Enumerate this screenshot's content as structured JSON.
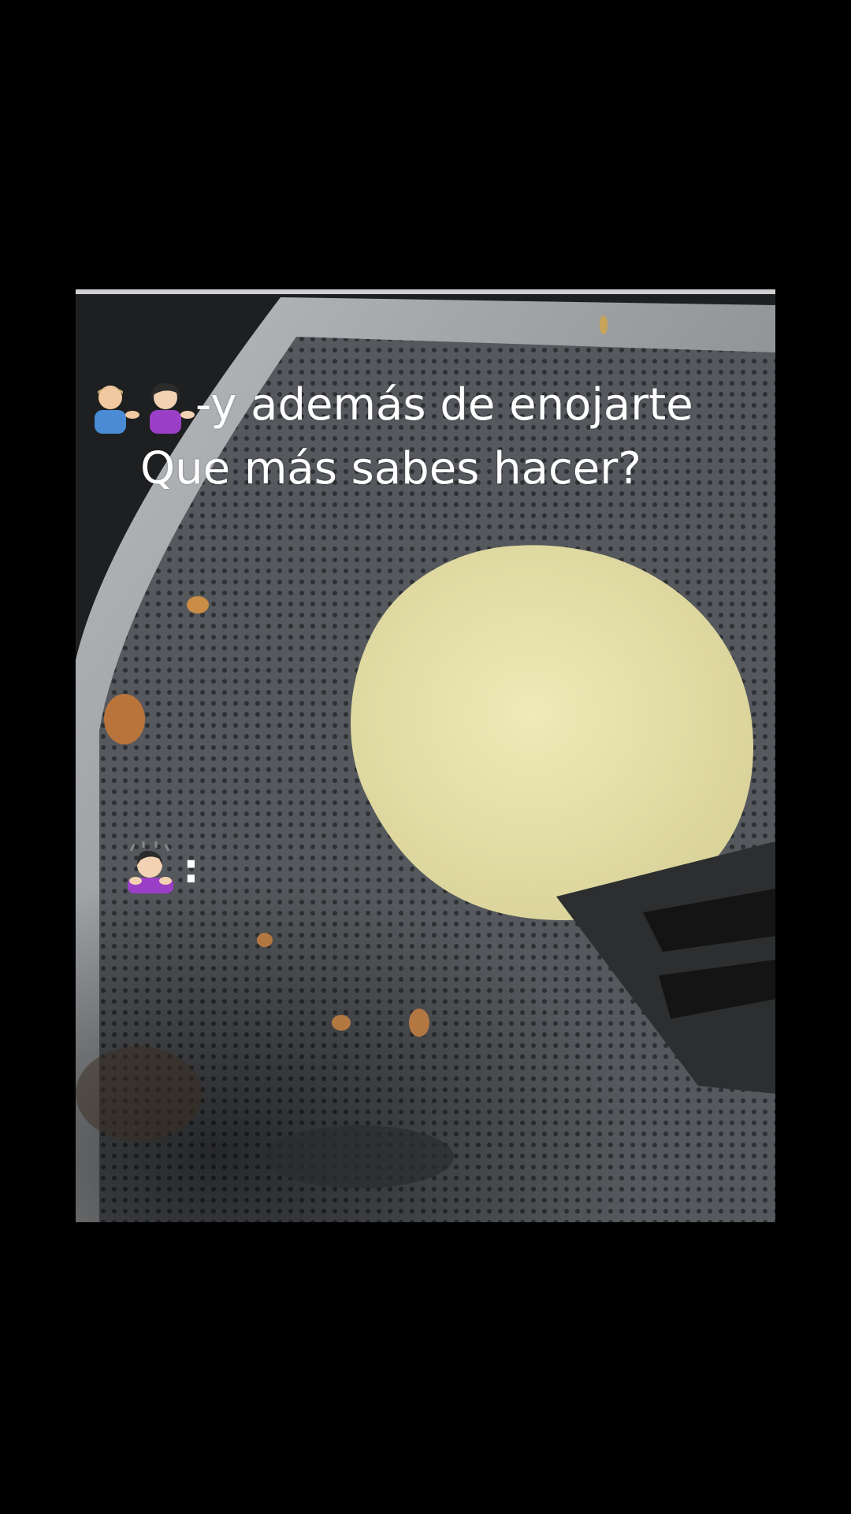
{
  "caption": {
    "line1_prefix_icons": [
      "man-tipping-hand-icon",
      "woman-tipping-hand-icon"
    ],
    "line1_text": "-y además de enojarte",
    "line2_text": "Que más sabes hacer?",
    "response_icon": "woman-bowing-icon",
    "response_text": ":"
  },
  "colors": {
    "background": "#000000",
    "pan": "#3a3c3f",
    "pan_rim": "#8a8d90",
    "pancake": "#e6e2a8",
    "spatula": "#2a2a2a"
  }
}
